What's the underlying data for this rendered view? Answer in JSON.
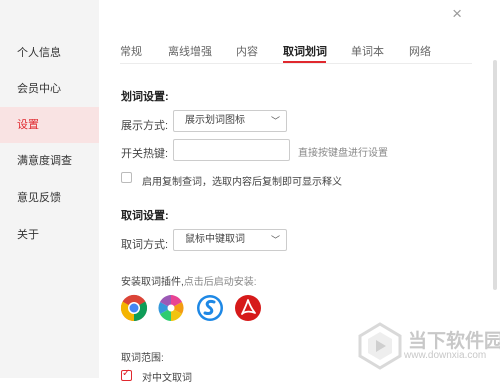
{
  "sidebar": {
    "items": [
      {
        "label": "个人信息"
      },
      {
        "label": "会员中心"
      },
      {
        "label": "设置"
      },
      {
        "label": "满意度调查"
      },
      {
        "label": "意见反馈"
      },
      {
        "label": "关于"
      }
    ],
    "active_index": 2
  },
  "window": {
    "close": "×"
  },
  "tabs": [
    {
      "label": "常规"
    },
    {
      "label": "离线增强"
    },
    {
      "label": "内容"
    },
    {
      "label": "取词划词"
    },
    {
      "label": "单词本"
    },
    {
      "label": "网络"
    }
  ],
  "active_tab": 3,
  "huaci": {
    "title": "划词设置:",
    "display_label": "展示方式:",
    "display_value": "展示划词图标",
    "hotkey_label": "开关热键:",
    "hotkey_value": "",
    "hotkey_hint": "直接按键盘进行设置",
    "copy_checkbox_label": "启用复制查词，选取内容后复制即可显示释义",
    "copy_checked": false
  },
  "quci": {
    "title": "取词设置:",
    "method_label": "取词方式:",
    "method_value": "鼠标中键取词"
  },
  "plugins": {
    "label": "安装取词插件,",
    "hint": "点击后启动安装:",
    "items": [
      {
        "icon": "chrome-icon"
      },
      {
        "icon": "pinwheel-browser-icon"
      },
      {
        "icon": "sogou-browser-icon"
      },
      {
        "icon": "acrobat-icon"
      }
    ]
  },
  "range": {
    "label": "取词范围:",
    "option_label": "对中文取词",
    "option_checked": true
  },
  "watermark": {
    "brand": "当下软件园",
    "url": "www.downxia.com"
  },
  "colors": {
    "accent": "#e0282e",
    "sidebar_bg": "#f4f4f4",
    "active_bg": "#f9e3e3"
  }
}
